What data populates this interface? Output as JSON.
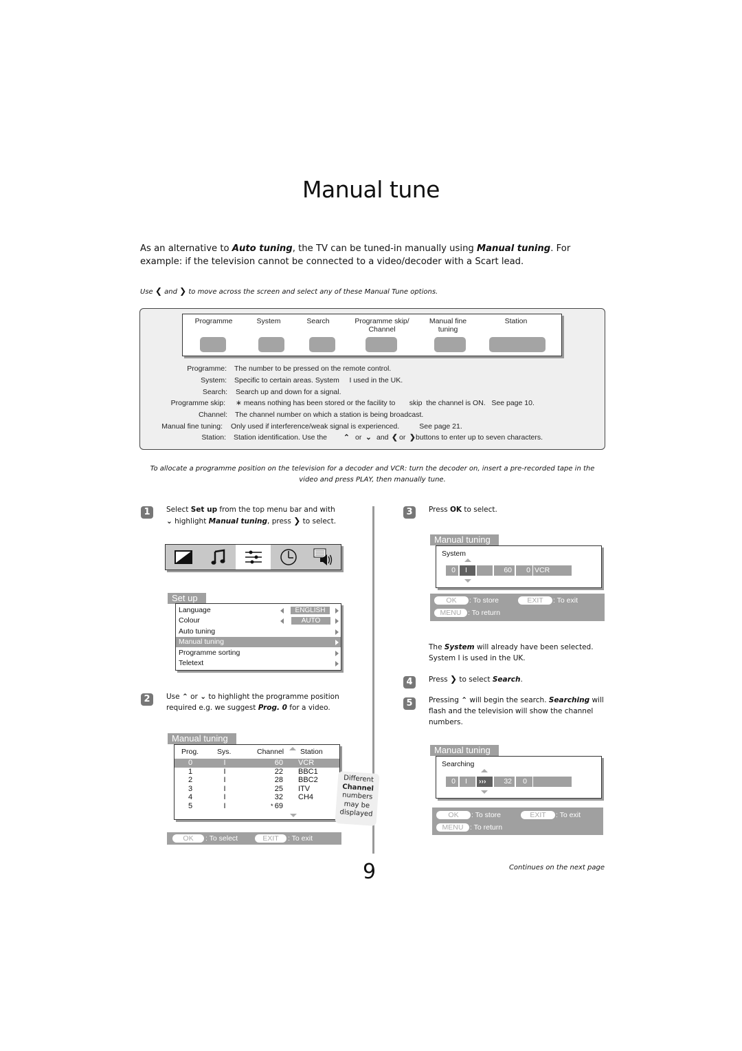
{
  "page": {
    "title": "Manual tune",
    "intro": {
      "part1": "As an alternative to ",
      "auto_tuning": "Auto tuning",
      "part2": ", the TV can be tuned-in manually using ",
      "manual_tuning": "Manual tuning",
      "part3": ". For example: if the television cannot be connected to a video/decoder with a Scart lead."
    },
    "use_line": {
      "use": "Use ",
      "and": " and ",
      "rest": " to move across the screen and select any of these Manual Tune options."
    },
    "page_number": "9",
    "continues": "Continues on the next page"
  },
  "options_panel": {
    "columns": [
      {
        "label": "Programme"
      },
      {
        "label": "System"
      },
      {
        "label": "Search"
      },
      {
        "label": "Programme skip/\nChannel"
      },
      {
        "label": "Manual fine\ntuning"
      },
      {
        "label": "Station"
      }
    ],
    "descriptions": [
      {
        "label": "Programme:",
        "text": "The number to be pressed on the remote control."
      },
      {
        "label": "System:",
        "text": "Specific to certain areas. System     I used in the UK."
      },
      {
        "label": "Search:",
        "text": "Search up and down for a signal."
      },
      {
        "label": "Programme skip:",
        "text": "∗ means nothing has been stored or the facility to       skip  the channel is ON.   See page 10."
      },
      {
        "label": "Channel:",
        "text": "The channel number on which a station is being broadcast."
      },
      {
        "label": "Manual fine tuning:",
        "text": "Only used if interference/weak signal is experienced.          See page 21."
      },
      {
        "label": "Station:",
        "text_a": "Station identification. Use the",
        "text_b": "or",
        "text_c": "and",
        "text_d": "or",
        "text_e": "buttons to enter up to seven characters."
      }
    ]
  },
  "allocate_note": "To allocate a programme position on the television for a decoder and VCR: turn the decoder on, insert a pre-recorded tape in the video and press PLAY, then manually tune.",
  "steps": [
    {
      "number": "1",
      "a": "Select ",
      "b": "Set up",
      "c": " from the top menu bar and with",
      "d": " highlight ",
      "e": "Manual tuning",
      "f": ", press ",
      "g": " to select."
    },
    {
      "number": "2",
      "a": "Use ",
      "b": " or ",
      "c": "  to highlight the programme position",
      "d": "required e.g. we suggest ",
      "e": "Prog. 0",
      "f": " for a video."
    },
    {
      "number": "3",
      "a": "Press ",
      "b": "OK",
      "c": " to select."
    },
    {
      "number": "4",
      "a": "Press ",
      "b": " to select ",
      "c": "Search",
      "d": "."
    },
    {
      "number": "5",
      "a": "Pressing ",
      "b": " will begin the search. ",
      "c": "Searching",
      "d": " will flash and the television will show the channel numbers."
    }
  ],
  "system_note": {
    "a": "The ",
    "b": "System",
    "c": " will already have been selected.",
    "d": "System I is used in the UK."
  },
  "menubar": {
    "icons": [
      "picture-icon",
      "sound-icon",
      "setup-icon",
      "timer-icon",
      "teletext-icon"
    ],
    "active_index": 2
  },
  "setup_menu": {
    "title": "Set up",
    "items": [
      {
        "label": "Language",
        "value": "ENGLISH"
      },
      {
        "label": "Colour",
        "value": "AUTO"
      },
      {
        "label": "Auto tuning"
      },
      {
        "label": "Manual tuning",
        "highlighted": true
      },
      {
        "label": "Programme sorting"
      },
      {
        "label": "Teletext"
      }
    ]
  },
  "manual_tuning_list": {
    "title": "Manual tuning",
    "headers": [
      "Prog.",
      "Sys.",
      "Channel",
      "Station"
    ],
    "rows": [
      {
        "prog": "0",
        "sys": "I",
        "skip": "",
        "channel": "60",
        "station": "VCR",
        "highlighted": true
      },
      {
        "prog": "1",
        "sys": "I",
        "skip": "",
        "channel": "22",
        "station": "BBC1"
      },
      {
        "prog": "2",
        "sys": "I",
        "skip": "",
        "channel": "28",
        "station": "BBC2"
      },
      {
        "prog": "3",
        "sys": "I",
        "skip": "",
        "channel": "25",
        "station": "ITV"
      },
      {
        "prog": "4",
        "sys": "I",
        "skip": "",
        "channel": "32",
        "station": "CH4"
      },
      {
        "prog": "5",
        "sys": "I",
        "skip": "*",
        "channel": "69",
        "station": ""
      }
    ],
    "help": {
      "ok": "OK",
      "ok_text": ": To select",
      "exit": "EXIT",
      "exit_text": ": To exit"
    }
  },
  "side_note": {
    "a": "Different",
    "b": "Channel",
    "c": "numbers",
    "d": "may be",
    "e": "displayed"
  },
  "tuning_system": {
    "title": "Manual tuning",
    "label": "System",
    "cells": [
      "0",
      "I",
      "",
      "60",
      "0",
      "VCR"
    ],
    "help": {
      "ok": "OK",
      "ok_text": ": To store",
      "exit": "EXIT",
      "exit_text": ": To exit",
      "menu": "MENU",
      "menu_text": ": To return"
    }
  },
  "tuning_search": {
    "title": "Manual tuning",
    "label": "Searching",
    "cells": [
      "0",
      "I",
      "›››",
      "32",
      "0",
      ""
    ],
    "help": {
      "ok": "OK",
      "ok_text": ": To store",
      "exit": "EXIT",
      "exit_text": ": To exit",
      "menu": "MENU",
      "menu_text": ": To return"
    }
  }
}
